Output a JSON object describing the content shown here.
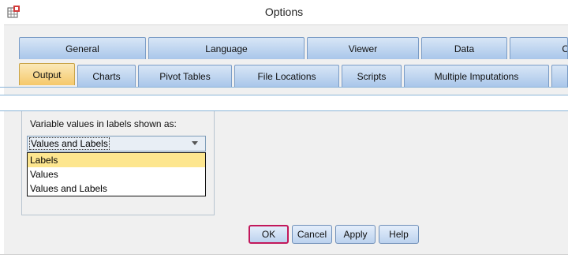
{
  "window": {
    "title": "Options",
    "app_icon": "spss-grid-icon"
  },
  "tabs_row1": [
    {
      "label": "General"
    },
    {
      "label": "Language"
    },
    {
      "label": "Viewer"
    },
    {
      "label": "Data"
    },
    {
      "label": "C"
    }
  ],
  "tabs_row2": [
    {
      "label": "Output",
      "active": true
    },
    {
      "label": "Charts"
    },
    {
      "label": "Pivot Tables"
    },
    {
      "label": "File Locations"
    },
    {
      "label": "Scripts"
    },
    {
      "label": "Multiple Imputations"
    }
  ],
  "variable_values": {
    "label_before": "Variable values in labels shown as:",
    "current_value": "Values and Labels",
    "options": [
      "Labels",
      "Values",
      "Values and Labels"
    ],
    "highlighted_option": "Labels"
  },
  "buttons": {
    "ok": "OK",
    "cancel": "Cancel",
    "apply": "Apply",
    "help": "Help"
  },
  "colors": {
    "tab_active": "#f5c86a",
    "tab_inactive": "#a9c6ea",
    "highlight": "#fde68f",
    "default_button_border": "#c2185b"
  }
}
